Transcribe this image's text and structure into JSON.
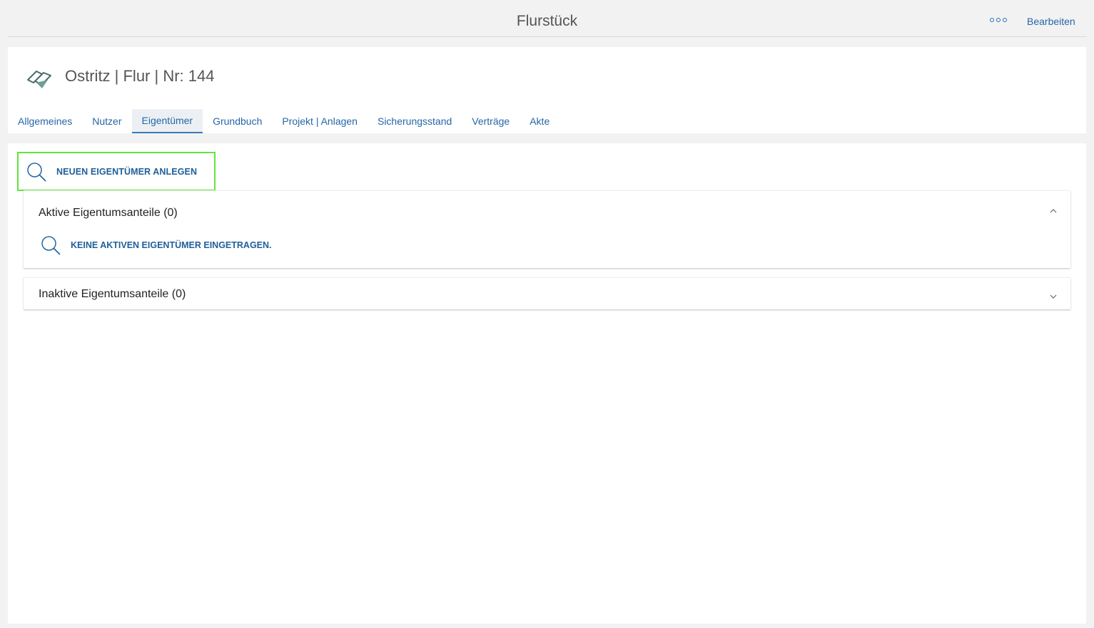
{
  "topbar": {
    "title": "Flurstück",
    "more_icon": "more-icon",
    "edit_label": "Bearbeiten"
  },
  "header": {
    "logo_icon": "parcel-icon",
    "record_title": "Ostritz | Flur | Nr: 144"
  },
  "tabs": [
    {
      "label": "Allgemeines",
      "active": false
    },
    {
      "label": "Nutzer",
      "active": false
    },
    {
      "label": "Eigentümer",
      "active": true
    },
    {
      "label": "Grundbuch",
      "active": false
    },
    {
      "label": "Projekt | Anlagen",
      "active": false
    },
    {
      "label": "Sicherungsstand",
      "active": false
    },
    {
      "label": "Verträge",
      "active": false
    },
    {
      "label": "Akte",
      "active": false
    }
  ],
  "actions": {
    "new_owner_label": "NEUEN EIGENTÜMER ANLEGEN",
    "new_owner_icon": "search-icon"
  },
  "panels": {
    "active": {
      "title": "Aktive Eigentumsanteile (0)",
      "expanded": true,
      "empty_label": "KEINE AKTIVEN EIGENTÜMER EINGETRAGEN."
    },
    "inactive": {
      "title": "Inaktive Eigentumsanteile (0)",
      "expanded": false
    }
  },
  "colors": {
    "accent": "#2467a5",
    "highlight_border": "#5fe73a",
    "background": "#f2f2f2"
  }
}
